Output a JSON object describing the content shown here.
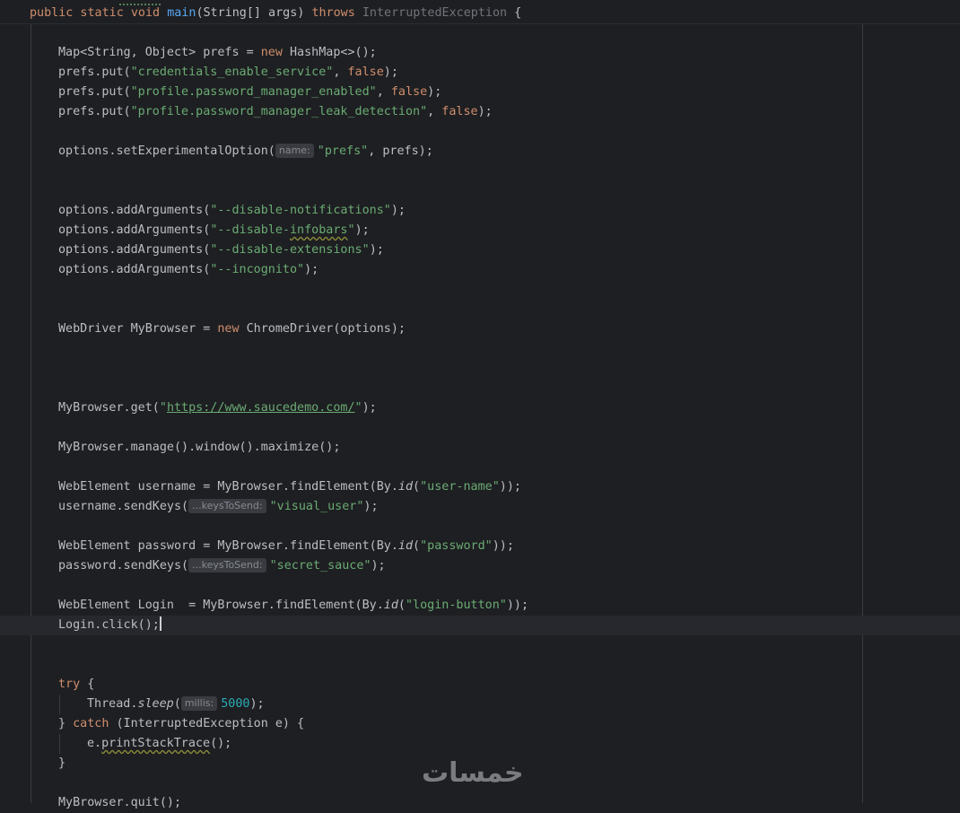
{
  "colors": {
    "background": "#1e1f22",
    "text": "#bcbec4",
    "keyword": "#cf8e6d",
    "string": "#6aab73",
    "method": "#56a8f5",
    "number": "#2aacb8",
    "hint_bg": "#393b40"
  },
  "code": {
    "sig": {
      "kw_mods": "public static void ",
      "name": "main",
      "params": "(String[] args) ",
      "kw_throws": "throws",
      "exc": " InterruptedException",
      "brace": " {"
    },
    "l_map": {
      "a": "Map<String, Object> prefs = ",
      "kw": "new",
      "b": " HashMap<>();"
    },
    "l_put1": {
      "a": "prefs.put(",
      "str": "\"credentials_enable_service\"",
      "b": ", ",
      "kw": "false",
      "c": ");"
    },
    "l_put2": {
      "a": "prefs.put(",
      "str": "\"profile.password_manager_enabled\"",
      "b": ", ",
      "kw": "false",
      "c": ");"
    },
    "l_put3": {
      "a": "prefs.put(",
      "str": "\"profile.password_manager_leak_detection\"",
      "b": ", ",
      "kw": "false",
      "c": ");"
    },
    "l_exp": {
      "a": "options.setExperimentalOption(",
      "hint": "name:",
      "str": "\"prefs\"",
      "b": ", prefs);"
    },
    "l_arg1": {
      "a": "options.addArguments(",
      "str": "\"--disable-notifications\"",
      "b": ");"
    },
    "l_arg2": {
      "a": "options.addArguments(",
      "str1": "\"--disable-",
      "str2": "infobars",
      "str3": "\"",
      "b": ");"
    },
    "l_arg3": {
      "a": "options.addArguments(",
      "str": "\"--disable-extensions\"",
      "b": ");"
    },
    "l_arg4": {
      "a": "options.addArguments(",
      "str": "\"--incognito\"",
      "b": ");"
    },
    "l_driver": {
      "a": "WebDriver MyBrowser = ",
      "kw": "new",
      "b": " ChromeDriver(options);"
    },
    "l_get": {
      "a": "MyBrowser.get(",
      "q1": "\"",
      "url": "https://www.saucedemo.com/",
      "q2": "\"",
      "b": ");"
    },
    "l_max": {
      "a": "MyBrowser.manage().window().maximize();"
    },
    "l_user": {
      "a": "WebElement username = MyBrowser.findElement(By.",
      "it": "id",
      "b": "(",
      "str": "\"user-name\"",
      "c": "));"
    },
    "l_user_send": {
      "a": "username.sendKeys(",
      "hint": "...keysToSend:",
      "str": "\"visual_user\"",
      "b": ");"
    },
    "l_pass": {
      "a": "WebElement password = MyBrowser.findElement(By.",
      "it": "id",
      "b": "(",
      "str": "\"password\"",
      "c": "));"
    },
    "l_pass_send": {
      "a": "password.sendKeys(",
      "hint": "...keysToSend:",
      "str": "\"secret_sauce\"",
      "b": ");"
    },
    "l_login": {
      "a": "WebElement Login  = MyBrowser.findElement(By.",
      "it": "id",
      "b": "(",
      "str": "\"login-button\"",
      "c": "));"
    },
    "l_click": {
      "a": "Login.click();"
    },
    "l_try": {
      "kw": "try",
      "b": " {"
    },
    "l_sleep": {
      "a": "Thread.",
      "it": "sleep",
      "b": "(",
      "hint": "millis:",
      "num": "5000",
      "c": ");"
    },
    "l_catch": {
      "a": "} ",
      "kw": "catch",
      "b": " (InterruptedException e) {"
    },
    "l_trace": {
      "a": "e.",
      "wavy": "printStackTrace",
      "b": "();"
    },
    "l_close": {
      "a": "}"
    },
    "l_quit": {
      "a": "MyBrowser.quit();"
    }
  },
  "watermark": {
    "text": "خمسات"
  }
}
